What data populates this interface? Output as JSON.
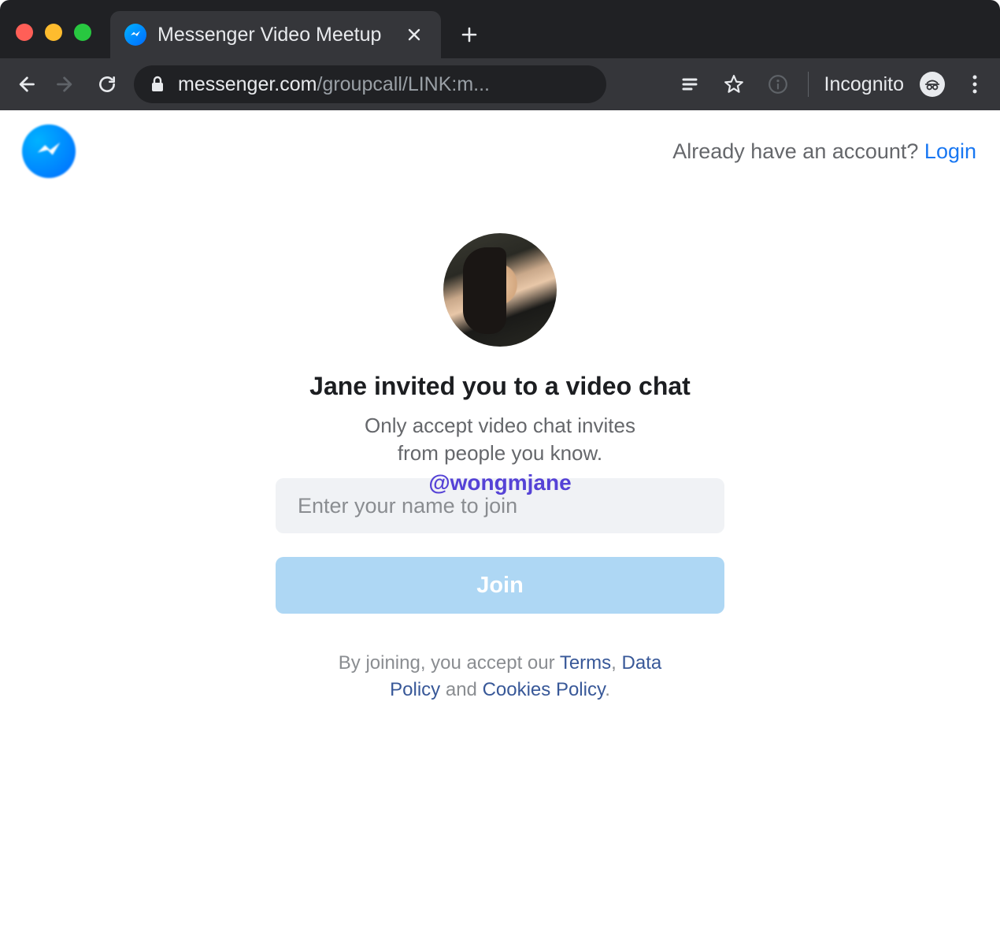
{
  "browser": {
    "tab_title": "Messenger Video Meetup",
    "url_domain": "messenger.com",
    "url_path": "/groupcall/LINK:m...",
    "incognito_label": "Incognito"
  },
  "header": {
    "account_prompt": "Already have an account? ",
    "login_label": "Login"
  },
  "card": {
    "title": "Jane invited you to a video chat",
    "subtitle": "Only accept video chat invites from people you know.",
    "watermark": "@wongmjane",
    "name_placeholder": "Enter your name to join",
    "join_label": "Join"
  },
  "legal": {
    "prefix": "By joining, you accept our ",
    "terms": "Terms",
    "sep1": ", ",
    "data_policy": "Data Policy",
    "sep2": " and ",
    "cookies": "Cookies Policy",
    "suffix": "."
  }
}
